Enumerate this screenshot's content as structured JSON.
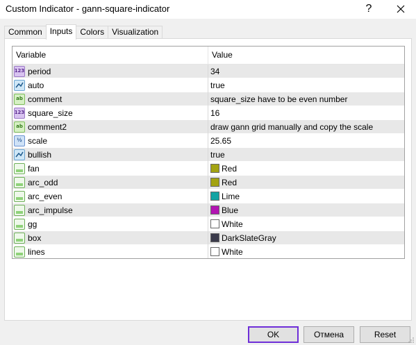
{
  "window": {
    "title": "Custom Indicator - gann-square-indicator",
    "help_glyph": "?"
  },
  "tabs": [
    {
      "label": "Common"
    },
    {
      "label": "Inputs"
    },
    {
      "label": "Colors"
    },
    {
      "label": "Visualization"
    }
  ],
  "grid": {
    "col_variable": "Variable",
    "col_value": "Value",
    "rows": [
      {
        "name": "period",
        "value": "34",
        "type": "int",
        "type_badge": "123"
      },
      {
        "name": "auto",
        "value": "true",
        "type": "bool"
      },
      {
        "name": "comment",
        "value": "square_size have to be even number",
        "type": "string",
        "type_badge": "ab"
      },
      {
        "name": "square_size",
        "value": "16",
        "type": "int",
        "type_badge": "123"
      },
      {
        "name": "comment2",
        "value": "draw gann grid manually and copy the scale",
        "type": "string",
        "type_badge": "ab"
      },
      {
        "name": "scale",
        "value": "25.65",
        "type": "double",
        "type_badge": "½"
      },
      {
        "name": "bullish",
        "value": "true",
        "type": "bool"
      },
      {
        "name": "fan",
        "value": "Red",
        "type": "color",
        "swatch": "#a3a312"
      },
      {
        "name": "arc_odd",
        "value": "Red",
        "type": "color",
        "swatch": "#a3a312"
      },
      {
        "name": "arc_even",
        "value": "Lime",
        "type": "color",
        "swatch": "#14a3a3"
      },
      {
        "name": "arc_impulse",
        "value": "Blue",
        "type": "color",
        "swatch": "#b214b2"
      },
      {
        "name": "gg",
        "value": "White",
        "type": "color",
        "swatch": "#ffffff"
      },
      {
        "name": "box",
        "value": "DarkSlateGray",
        "type": "color",
        "swatch": "#3a3a4a"
      },
      {
        "name": "lines",
        "value": "White",
        "type": "color",
        "swatch": "#ffffff"
      }
    ]
  },
  "buttons": {
    "ok": "OK",
    "cancel": "Отмена",
    "reset": "Reset"
  },
  "colors": {
    "ok_border": "#6e2ed8",
    "alt_row": "#e8e8e8"
  }
}
